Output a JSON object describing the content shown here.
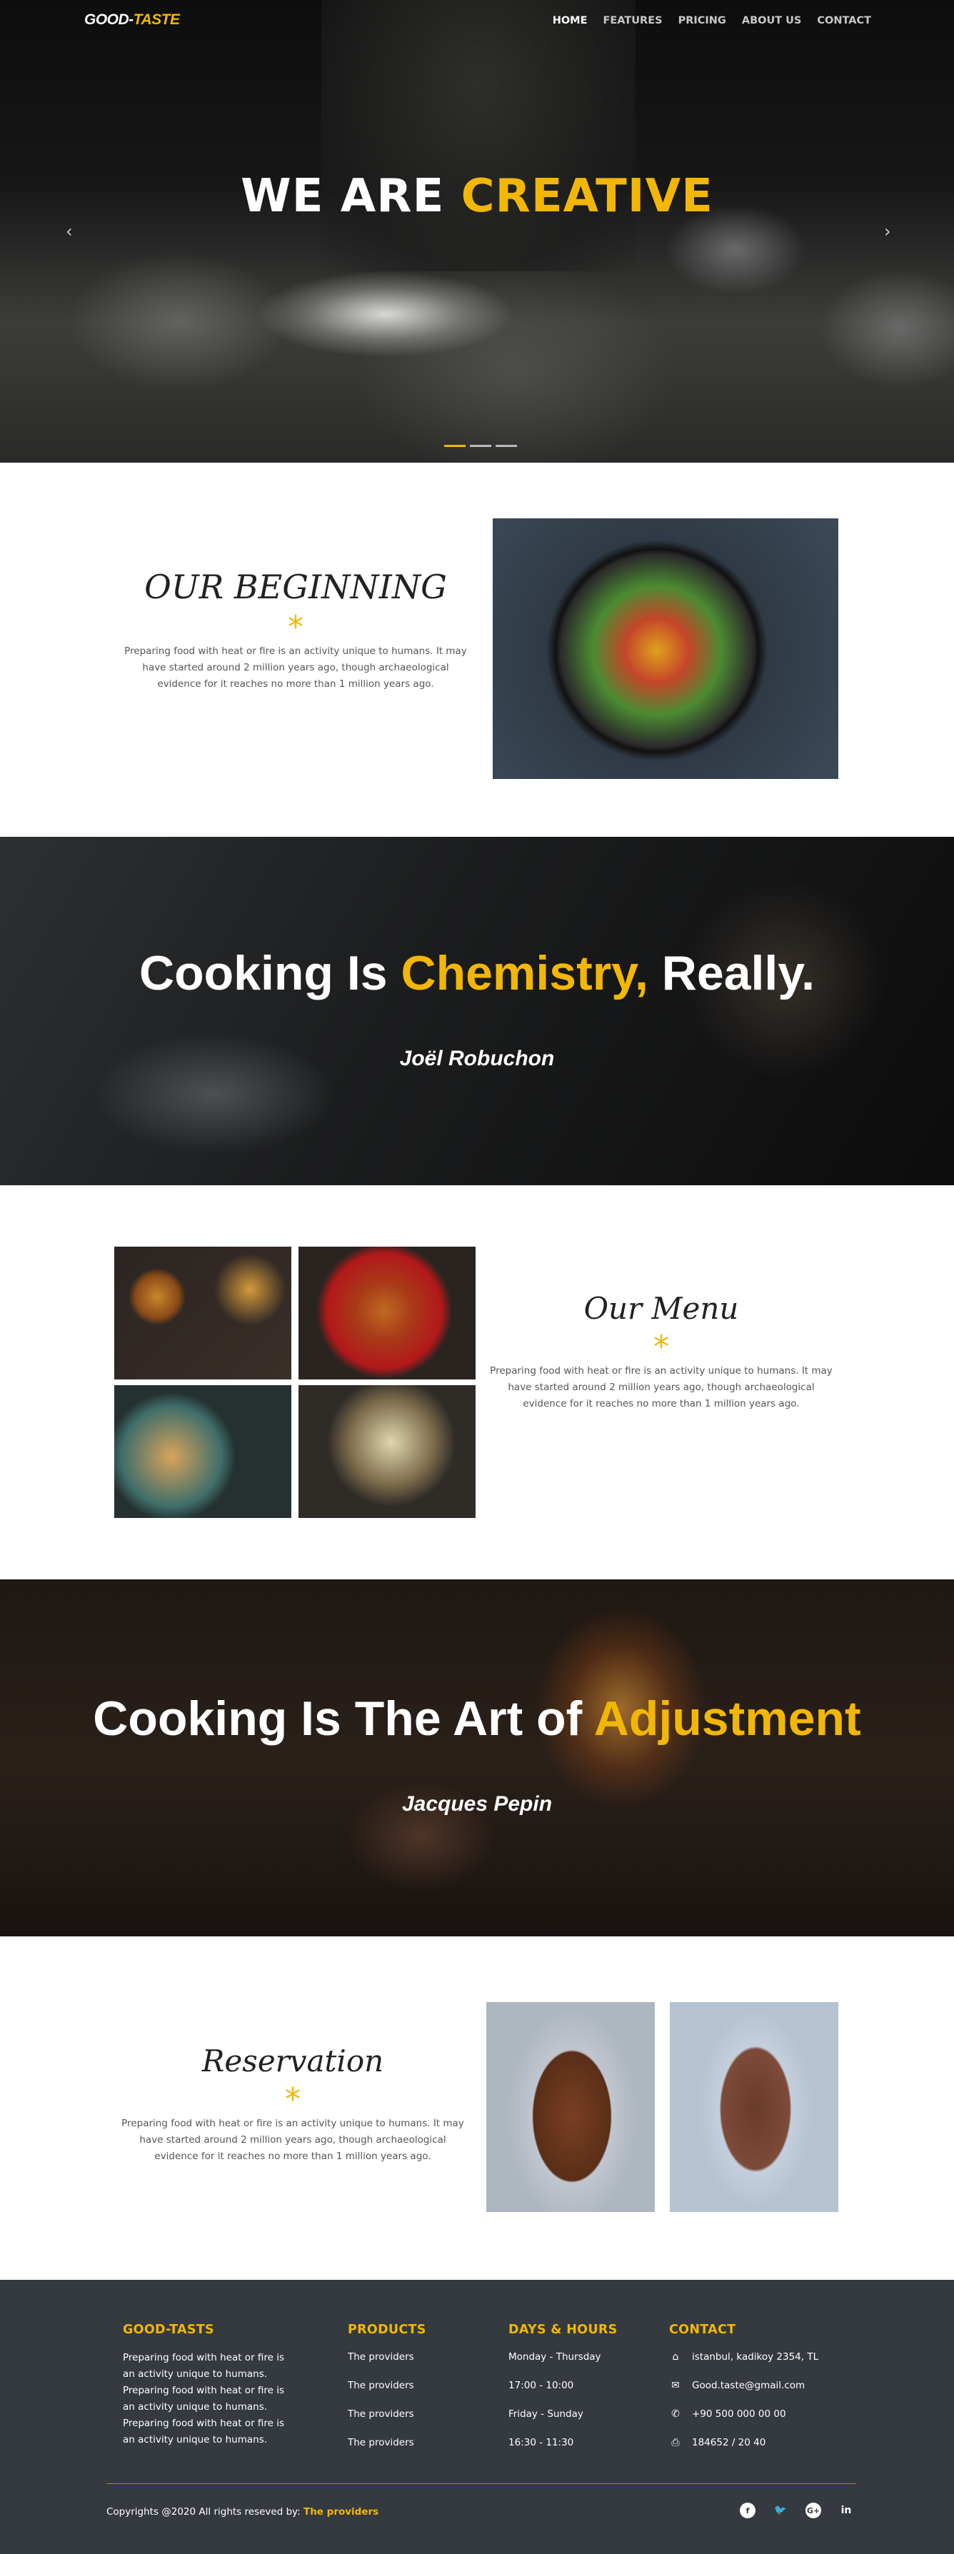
{
  "brand": {
    "name_part1": "GOOD-",
    "name_part2": "TASTE"
  },
  "nav": {
    "items": [
      "HOME",
      "FEATURES",
      "PRICING",
      "ABOUT US",
      "CONTACT"
    ],
    "active": "HOME"
  },
  "hero": {
    "title_part1": "WE ARE ",
    "title_part2": "CREATIVE",
    "prev_arrow": "‹",
    "next_arrow": "›",
    "slides": 3,
    "active_slide": 1
  },
  "beginning": {
    "title": "OUR BEGINNING",
    "star": "*",
    "text": "Preparing food with heat or fire is an activity unique to humans. It may have started around 2 million years ago, though archaeological evidence for it reaches no more than 1 million years ago."
  },
  "quote1": {
    "part1": "Cooking Is ",
    "part2": "Chemistry,",
    "part3": " Really.",
    "author": "Joël Robuchon"
  },
  "menu_section": {
    "title": "Our Menu",
    "star": "*",
    "text": "Preparing food with heat or fire is an activity unique to humans. It may have started around 2 million years ago, though archaeological evidence for it reaches no more than 1 million years ago."
  },
  "quote2": {
    "part1": "Cooking Is The Art of ",
    "part2": "Adjustment",
    "author": "Jacques Pepin"
  },
  "reservation": {
    "title": "Reservation",
    "star": "*",
    "text": "Preparing food with heat or fire is an activity unique to humans. It may have started around 2 million years ago, though archaeological evidence for it reaches no more than 1 million years ago."
  },
  "footer": {
    "about": {
      "heading": "GOOD-TASTS",
      "lines": [
        "Preparing food with heat or fire is",
        "an activity unique to humans.",
        "Preparing food with heat or fire is",
        "an activity unique to humans.",
        "Preparing food with heat or fire is",
        "an activity unique to humans."
      ]
    },
    "products": {
      "heading": "PRODUCTS",
      "items": [
        "The providers",
        "The providers",
        "The providers",
        "The providers"
      ]
    },
    "hours": {
      "heading": "DAYS & HOURS",
      "items": [
        "Monday - Thursday",
        "17:00 - 10:00",
        "Friday - Sunday",
        "16:30 - 11:30"
      ]
    },
    "contact": {
      "heading": "CONTACT",
      "address": "istanbul, kadikoy 2354, TL",
      "email": "Good.taste@gmail.com",
      "phone": "+90 500 000 00 00",
      "fax": "184652 / 20 40"
    },
    "copyright_text": "Copyrights @2020 All rights reseved by: ",
    "copyright_link": "The providers",
    "social": [
      "facebook-icon",
      "twitter-icon",
      "google-plus-icon",
      "linkedin-icon"
    ]
  },
  "colors": {
    "accent": "#f2b705",
    "footer_bg": "#343a40",
    "text": "#555555"
  }
}
